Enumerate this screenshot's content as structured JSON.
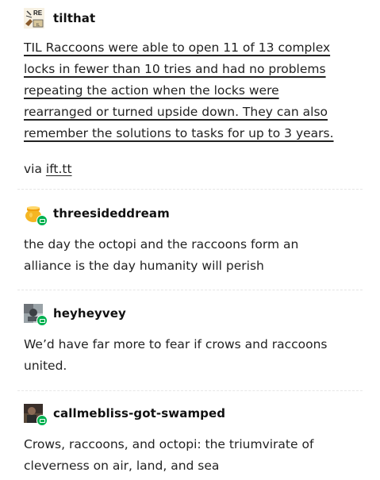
{
  "posts": [
    {
      "username": "tilthat",
      "avatar": "reddit-til-avatar",
      "lines": [
        "TIL Raccoons were able to open 11 of 13 complex",
        "locks in fewer than 10 tries and had no problems",
        "repeating the action when the locks were",
        "rearranged or turned upside down. They can also",
        "remember the solutions to tasks for up to 3 years."
      ],
      "via_prefix": "via ",
      "via_link": "ift.tt",
      "avatar_text": "RE"
    },
    {
      "username": "threesideddream",
      "avatar": "honey-pot-avatar",
      "lines": [
        "the day the octopi and the raccoons form an",
        "alliance is the day humanity will perish"
      ]
    },
    {
      "username": "heyheyvey",
      "avatar": "photo-avatar",
      "lines": [
        "We’d have far more to fear if crows and raccoons",
        "united."
      ]
    },
    {
      "username": "callmebliss-got-swamped",
      "avatar": "dark-photo-avatar",
      "lines": [
        "Crows, raccoons, and octopi: the triumvirate of",
        "cleverness on air, land, and sea"
      ]
    }
  ],
  "colors": {
    "text": "#222222",
    "badge": "#00b04f",
    "separator": "#e6e6e6"
  }
}
